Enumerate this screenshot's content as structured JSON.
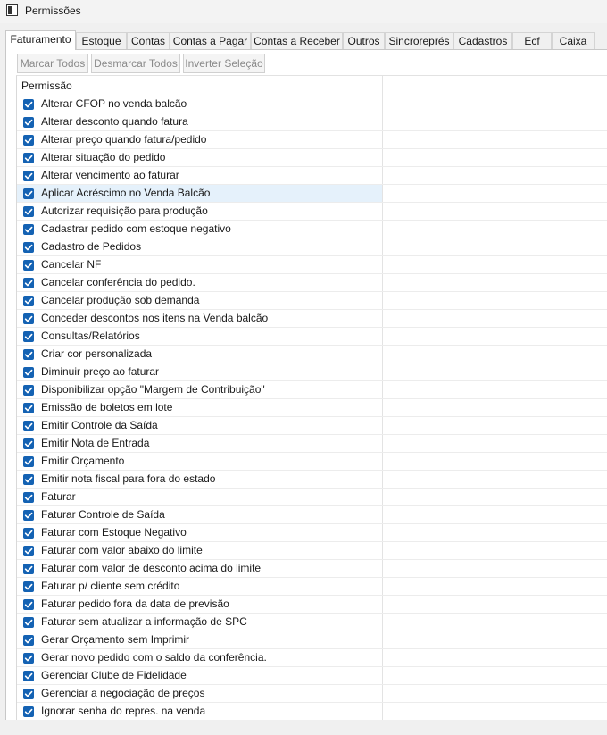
{
  "window": {
    "title": "Permissões"
  },
  "tabs": [
    {
      "label": "Faturamento",
      "active": true
    },
    {
      "label": "Estoque",
      "active": false
    },
    {
      "label": "Contas",
      "active": false
    },
    {
      "label": "Contas a Pagar",
      "active": false
    },
    {
      "label": "Contas a Receber",
      "active": false
    },
    {
      "label": "Outros",
      "active": false
    },
    {
      "label": "Sincroreprés",
      "active": false
    },
    {
      "label": "Cadastros",
      "active": false
    },
    {
      "label": "Ecf",
      "active": false
    },
    {
      "label": "Caixa",
      "active": false
    }
  ],
  "toolbar": {
    "mark_all": "Marcar Todos",
    "unmark_all": "Desmarcar Todos",
    "invert": "Inverter Seleção"
  },
  "grid": {
    "header": "Permissão",
    "hover_row_index": 5,
    "rows": [
      {
        "label": "Alterar CFOP no venda balcão",
        "checked": true
      },
      {
        "label": "Alterar desconto quando fatura",
        "checked": true
      },
      {
        "label": "Alterar preço quando fatura/pedido",
        "checked": true
      },
      {
        "label": "Alterar situação do pedido",
        "checked": true
      },
      {
        "label": "Alterar vencimento ao faturar",
        "checked": true
      },
      {
        "label": "Aplicar Acréscimo no Venda Balcão",
        "checked": true
      },
      {
        "label": "Autorizar requisição para produção",
        "checked": true
      },
      {
        "label": "Cadastrar pedido com estoque negativo",
        "checked": true
      },
      {
        "label": "Cadastro de Pedidos",
        "checked": true
      },
      {
        "label": "Cancelar NF",
        "checked": true
      },
      {
        "label": "Cancelar conferência do pedido.",
        "checked": true
      },
      {
        "label": "Cancelar produção sob demanda",
        "checked": true
      },
      {
        "label": "Conceder descontos nos itens na Venda balcão",
        "checked": true
      },
      {
        "label": "Consultas/Relatórios",
        "checked": true
      },
      {
        "label": "Criar cor personalizada",
        "checked": true
      },
      {
        "label": "Diminuir preço ao faturar",
        "checked": true
      },
      {
        "label": "Disponibilizar opção \"Margem de Contribuição\"",
        "checked": true
      },
      {
        "label": "Emissão de boletos em lote",
        "checked": true
      },
      {
        "label": "Emitir Controle da Saída",
        "checked": true
      },
      {
        "label": "Emitir Nota de Entrada",
        "checked": true
      },
      {
        "label": "Emitir Orçamento",
        "checked": true
      },
      {
        "label": "Emitir nota fiscal para fora do estado",
        "checked": true
      },
      {
        "label": "Faturar",
        "checked": true
      },
      {
        "label": "Faturar Controle de Saída",
        "checked": true
      },
      {
        "label": "Faturar com Estoque Negativo",
        "checked": true
      },
      {
        "label": "Faturar com valor abaixo do limite",
        "checked": true
      },
      {
        "label": "Faturar com valor de desconto acima do limite",
        "checked": true
      },
      {
        "label": "Faturar p/ cliente sem crédito",
        "checked": true
      },
      {
        "label": "Faturar pedido fora da data de previsão",
        "checked": true
      },
      {
        "label": "Faturar sem atualizar a informação de SPC",
        "checked": true
      },
      {
        "label": "Gerar Orçamento sem Imprimir",
        "checked": true
      },
      {
        "label": "Gerar novo pedido com o saldo da conferência.",
        "checked": true
      },
      {
        "label": "Gerenciar Clube de Fidelidade",
        "checked": true
      },
      {
        "label": "Gerenciar a negociação de preços",
        "checked": true
      },
      {
        "label": "Ignorar senha do repres. na venda",
        "checked": true
      }
    ]
  },
  "colors": {
    "checkbox": "#1462b3",
    "hover": "#e5f1fb"
  }
}
